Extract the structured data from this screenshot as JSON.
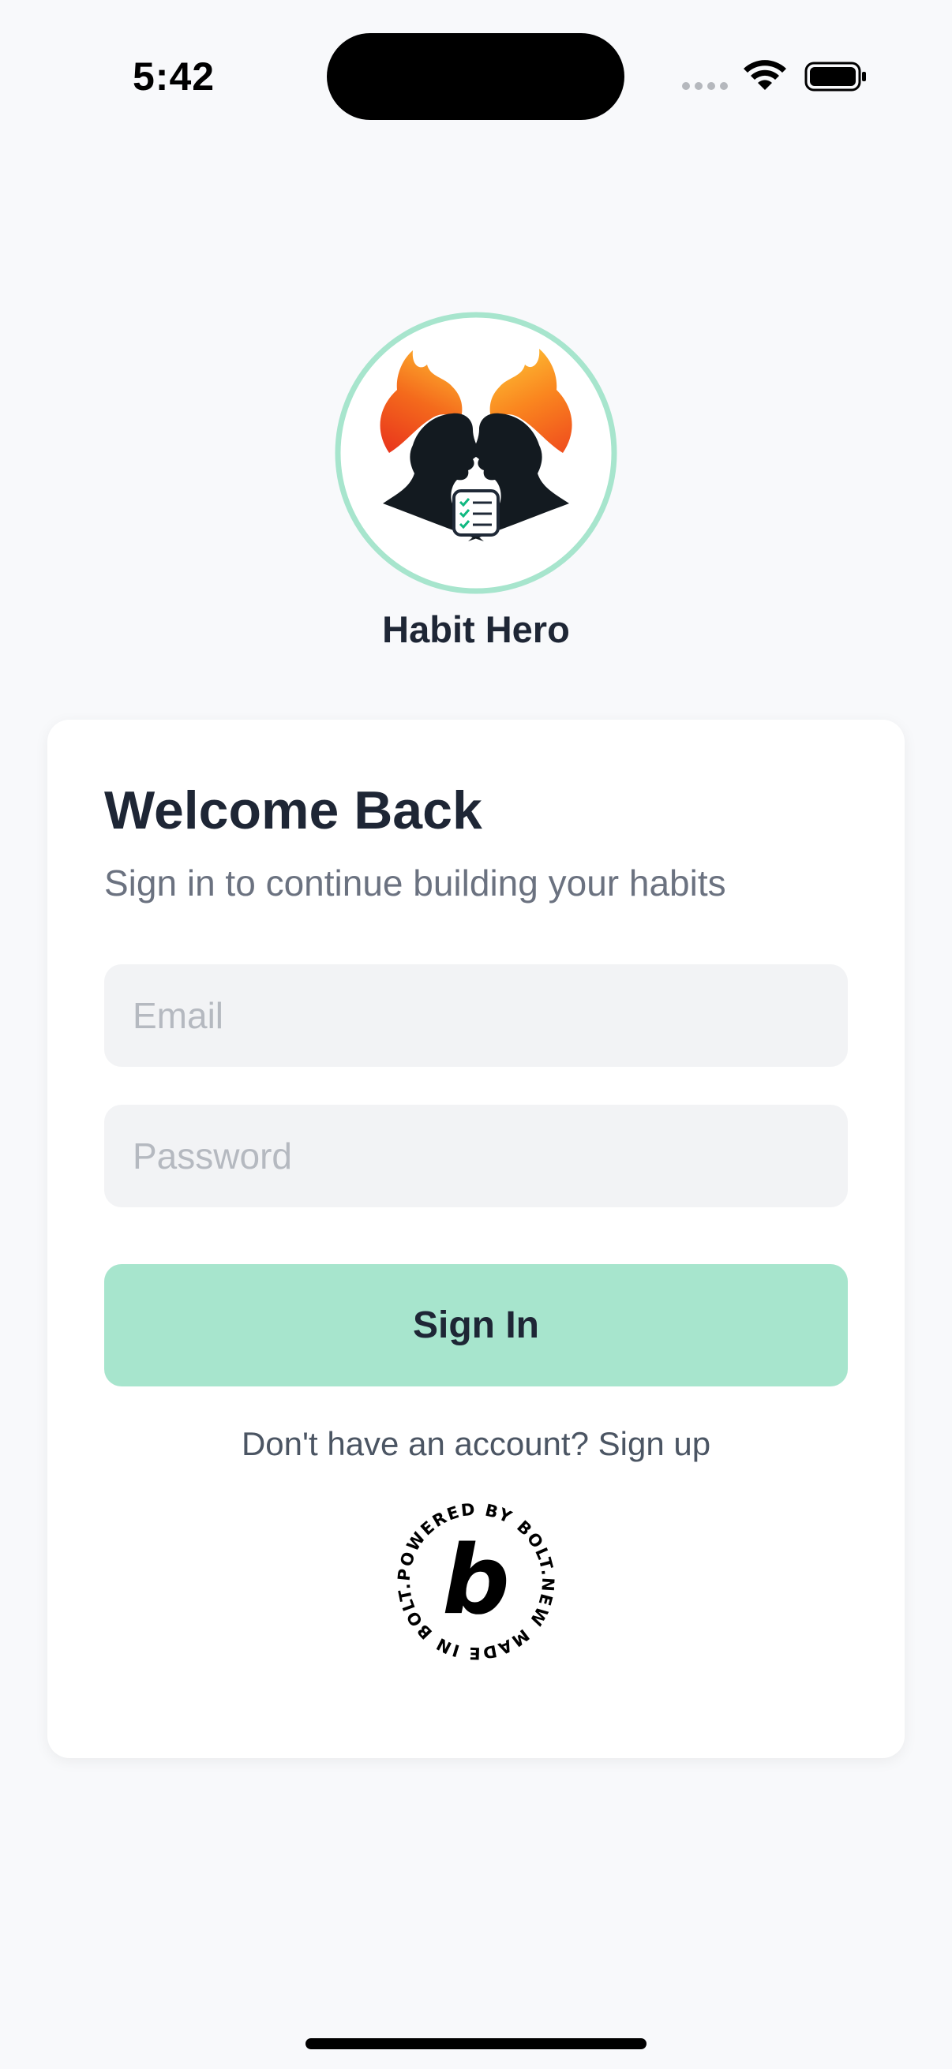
{
  "status_bar": {
    "time": "5:42",
    "wifi_icon": "wifi-icon",
    "battery_icon": "battery-icon",
    "signal_icon": "cellular-signal-icon"
  },
  "app": {
    "name": "Habit Hero",
    "logo_icon": "habit-hero-logo",
    "accent_color": "#a7e5cd"
  },
  "login": {
    "heading": "Welcome Back",
    "subtitle": "Sign in to continue building your habits",
    "email_placeholder": "Email",
    "email_value": "",
    "password_placeholder": "Password",
    "password_value": "",
    "sign_in_label": "Sign In",
    "signup_prompt": "Don't have an account?",
    "signup_link": "Sign up"
  },
  "badge": {
    "ring_text": "POWERED BY BOLT.NEW MADE IN BOLT.NEW",
    "letter": "b",
    "icon": "bolt-badge-icon"
  }
}
